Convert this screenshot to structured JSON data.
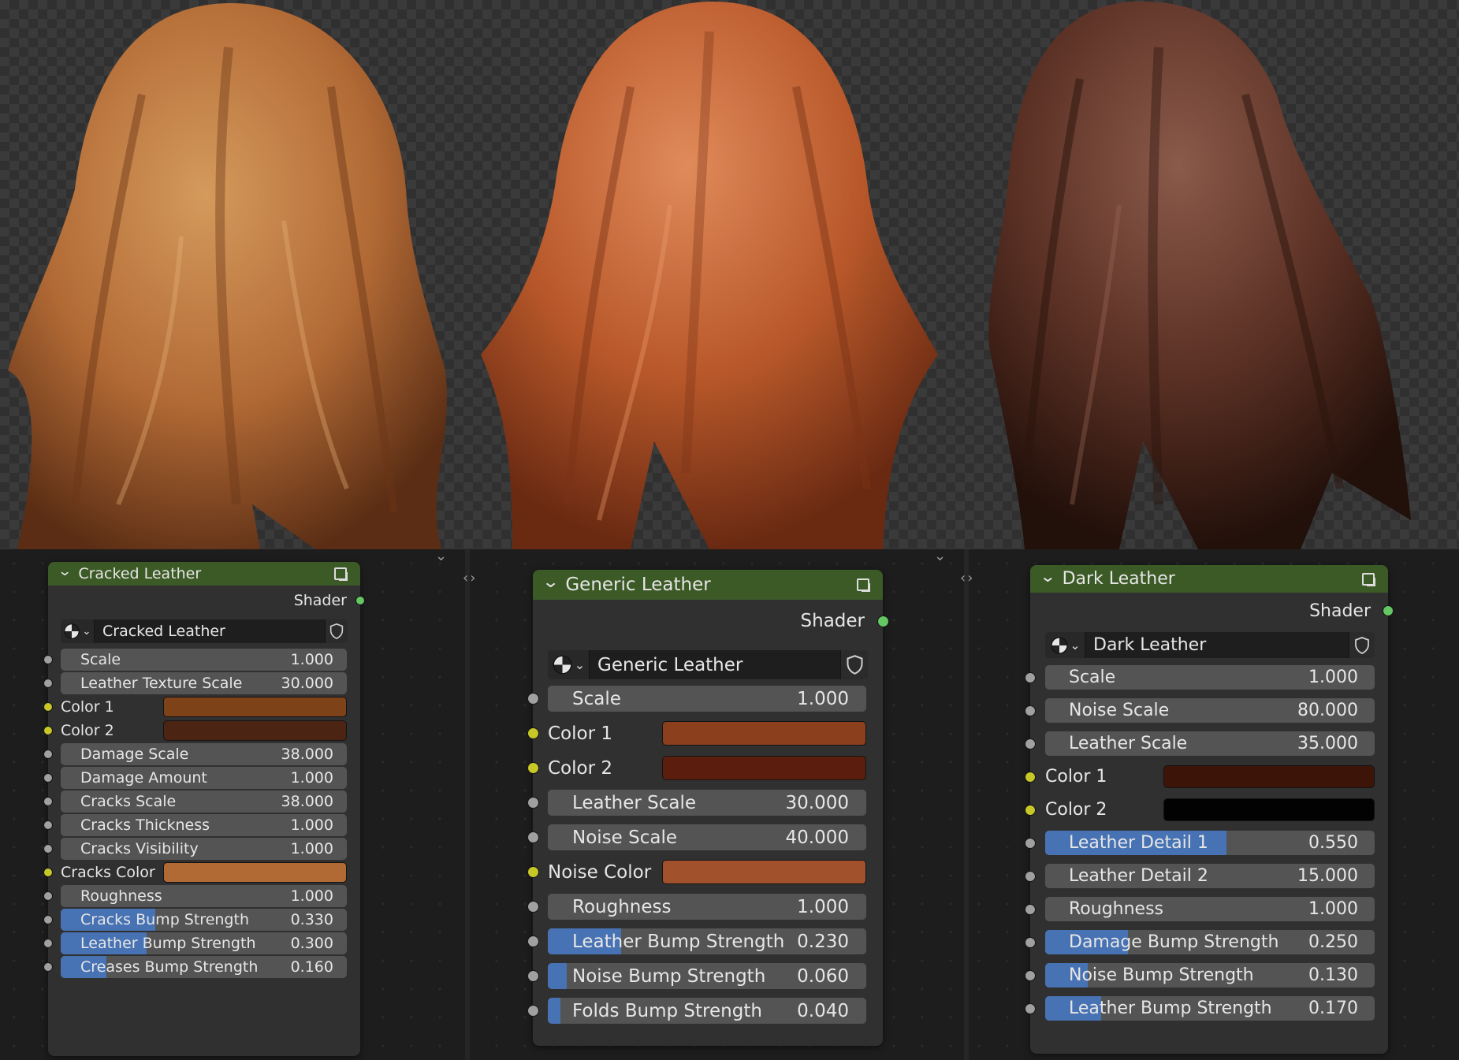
{
  "nodes": [
    {
      "title": "Cracked Leather",
      "output_label": "Shader",
      "material_name": "Cracked Leather",
      "inputs": [
        {
          "label": "Scale",
          "value": "1.000",
          "kind": "value",
          "fill": 0
        },
        {
          "label": "Leather Texture Scale",
          "value": "30.000",
          "kind": "value",
          "fill": 0
        },
        {
          "label": "Color 1",
          "kind": "color",
          "color": "#7e4219"
        },
        {
          "label": "Color 2",
          "kind": "color",
          "color": "#4b2413"
        },
        {
          "label": "Damage Scale",
          "value": "38.000",
          "kind": "value",
          "fill": 0
        },
        {
          "label": "Damage Amount",
          "value": "1.000",
          "kind": "value",
          "fill": 0
        },
        {
          "label": "Cracks Scale",
          "value": "38.000",
          "kind": "value",
          "fill": 0
        },
        {
          "label": "Cracks Thickness",
          "value": "1.000",
          "kind": "value",
          "fill": 0
        },
        {
          "label": "Cracks Visibility",
          "value": "1.000",
          "kind": "value",
          "fill": 0
        },
        {
          "label": "Cracks Color",
          "kind": "color",
          "color": "#b26a35"
        },
        {
          "label": "Roughness",
          "value": "1.000",
          "kind": "value",
          "fill": 0
        },
        {
          "label": "Cracks Bump Strength",
          "value": "0.330",
          "kind": "value",
          "fill": 0.33
        },
        {
          "label": "Leather Bump Strength",
          "value": "0.300",
          "kind": "value",
          "fill": 0.3
        },
        {
          "label": "Creases Bump Strength",
          "value": "0.160",
          "kind": "value",
          "fill": 0.16
        }
      ]
    },
    {
      "title": "Generic Leather",
      "output_label": "Shader",
      "material_name": "Generic Leather",
      "inputs": [
        {
          "label": "Scale",
          "value": "1.000",
          "kind": "value",
          "fill": 0
        },
        {
          "label": "Color 1",
          "kind": "color",
          "color": "#8c3f1d"
        },
        {
          "label": "Color 2",
          "kind": "color",
          "color": "#5a1d0e"
        },
        {
          "label": "Leather Scale",
          "value": "30.000",
          "kind": "value",
          "fill": 0
        },
        {
          "label": "Noise Scale",
          "value": "40.000",
          "kind": "value",
          "fill": 0
        },
        {
          "label": "Noise Color",
          "kind": "color",
          "color": "#a1522c"
        },
        {
          "label": "Roughness",
          "value": "1.000",
          "kind": "value",
          "fill": 0
        },
        {
          "label": "Leather Bump Strength",
          "value": "0.230",
          "kind": "value",
          "fill": 0.23
        },
        {
          "label": "Noise Bump Strength",
          "value": "0.060",
          "kind": "value",
          "fill": 0.06
        },
        {
          "label": "Folds Bump Strength",
          "value": "0.040",
          "kind": "value",
          "fill": 0.04
        }
      ]
    },
    {
      "title": "Dark Leather",
      "output_label": "Shader",
      "material_name": "Dark Leather",
      "inputs": [
        {
          "label": "Scale",
          "value": "1.000",
          "kind": "value",
          "fill": 0
        },
        {
          "label": "Noise Scale",
          "value": "80.000",
          "kind": "value",
          "fill": 0
        },
        {
          "label": "Leather Scale",
          "value": "35.000",
          "kind": "value",
          "fill": 0
        },
        {
          "label": "Color 1",
          "kind": "color",
          "color": "#3d1408"
        },
        {
          "label": "Color 2",
          "kind": "color",
          "color": "#030202"
        },
        {
          "label": "Leather Detail 1",
          "value": "0.550",
          "kind": "value",
          "fill": 0.55
        },
        {
          "label": "Leather Detail 2",
          "value": "15.000",
          "kind": "value",
          "fill": 0
        },
        {
          "label": "Roughness",
          "value": "1.000",
          "kind": "value",
          "fill": 0
        },
        {
          "label": "Damage Bump Strength",
          "value": "0.250",
          "kind": "value",
          "fill": 0.25
        },
        {
          "label": "Noise Bump Strength",
          "value": "0.130",
          "kind": "value",
          "fill": 0.13
        },
        {
          "label": "Leather Bump Strength",
          "value": "0.170",
          "kind": "value",
          "fill": 0.17
        }
      ]
    }
  ],
  "preview_materials": [
    {
      "name": "cracked-leather",
      "base": "#b26a35",
      "dark": "#5a2d14",
      "light": "#d49a5c"
    },
    {
      "name": "generic-leather",
      "base": "#b8582a",
      "dark": "#6a2a12",
      "light": "#e08a5a"
    },
    {
      "name": "dark-leather",
      "base": "#5a3024",
      "dark": "#22100a",
      "light": "#8a5a4a"
    }
  ],
  "icons": {
    "collapse": "chevron-down-icon",
    "group": "node-group-icon",
    "material_ball": "material-ball-icon",
    "fake_user": "shield-icon",
    "swap": "swap-arrows-icon"
  },
  "colors": {
    "header_green": "#3c5a26",
    "slider_fill": "#4772b3",
    "field_bg": "#545454",
    "socket_gray": "#a0a0a0",
    "socket_yellow": "#c7c729",
    "socket_green": "#63c763"
  }
}
